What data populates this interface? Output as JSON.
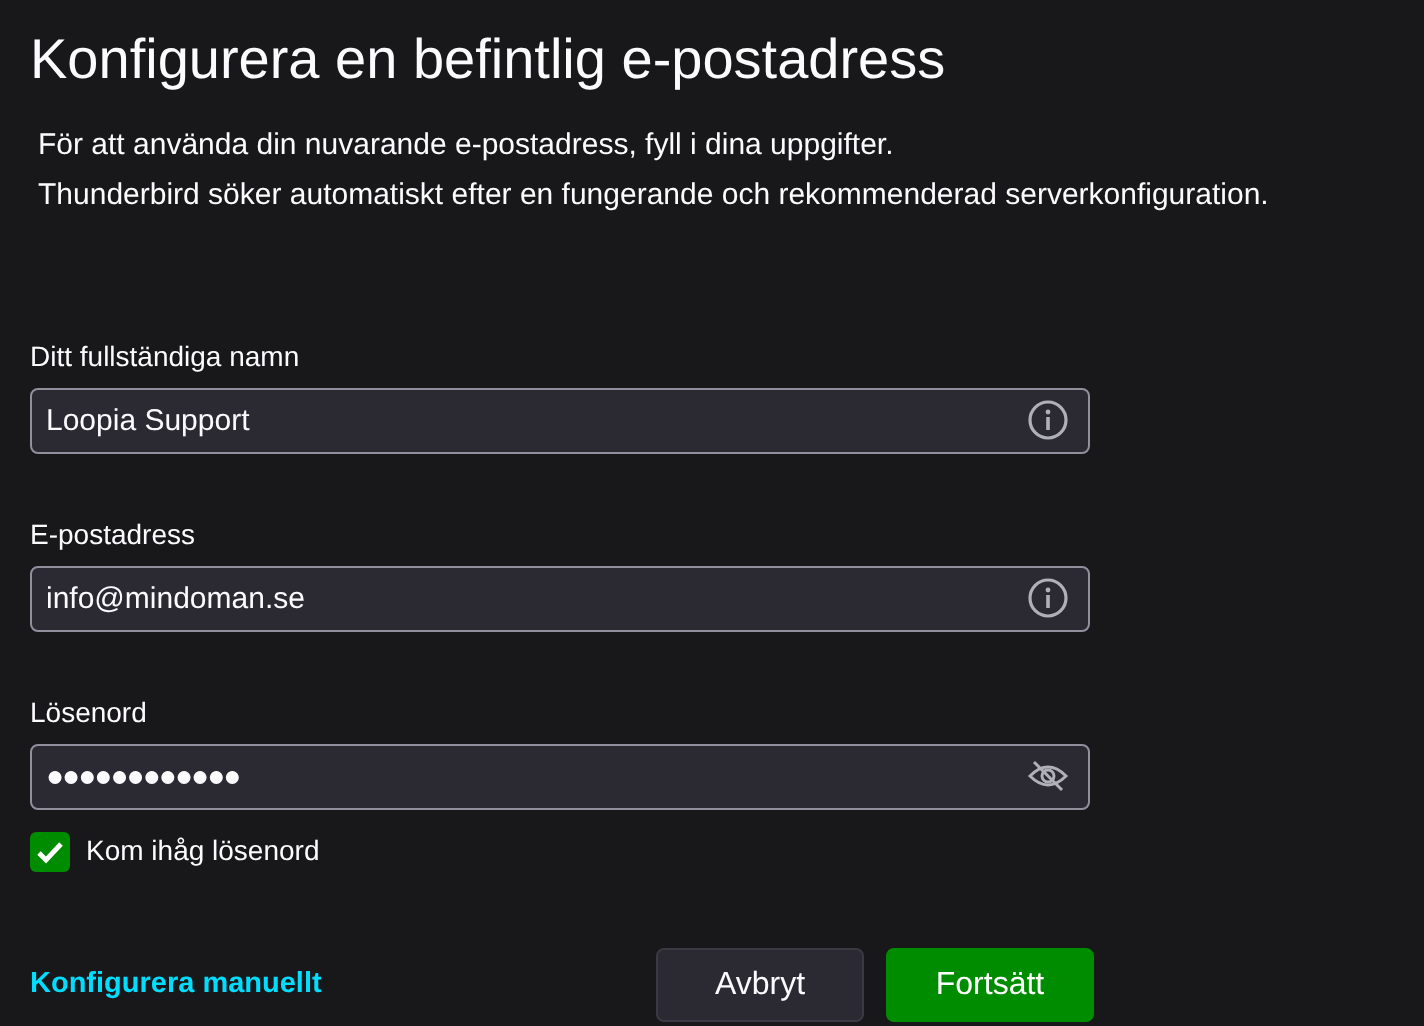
{
  "title": "Konfigurera en befintlig e-postadress",
  "intro": [
    "För att använda din nuvarande e-postadress, fyll i dina uppgifter.",
    "Thunderbird söker automatiskt efter en fungerande och rekommenderad serverkonfiguration."
  ],
  "fields": [
    {
      "label": "Ditt fullständiga namn",
      "value": "Loopia Support",
      "kind": "info"
    },
    {
      "label": "E-postadress",
      "value": "info@mindoman.se",
      "kind": "info"
    },
    {
      "label": "Lösenord",
      "value": "●●●●●●●●●●●●",
      "kind": "password"
    }
  ],
  "remember": {
    "label": "Kom ihåg lösenord",
    "checked": true
  },
  "manual_link": "Konfigurera manuellt",
  "buttons": [
    {
      "label": "Avbryt",
      "kind": "secondary"
    },
    {
      "label": "Fortsätt",
      "kind": "primary"
    }
  ]
}
